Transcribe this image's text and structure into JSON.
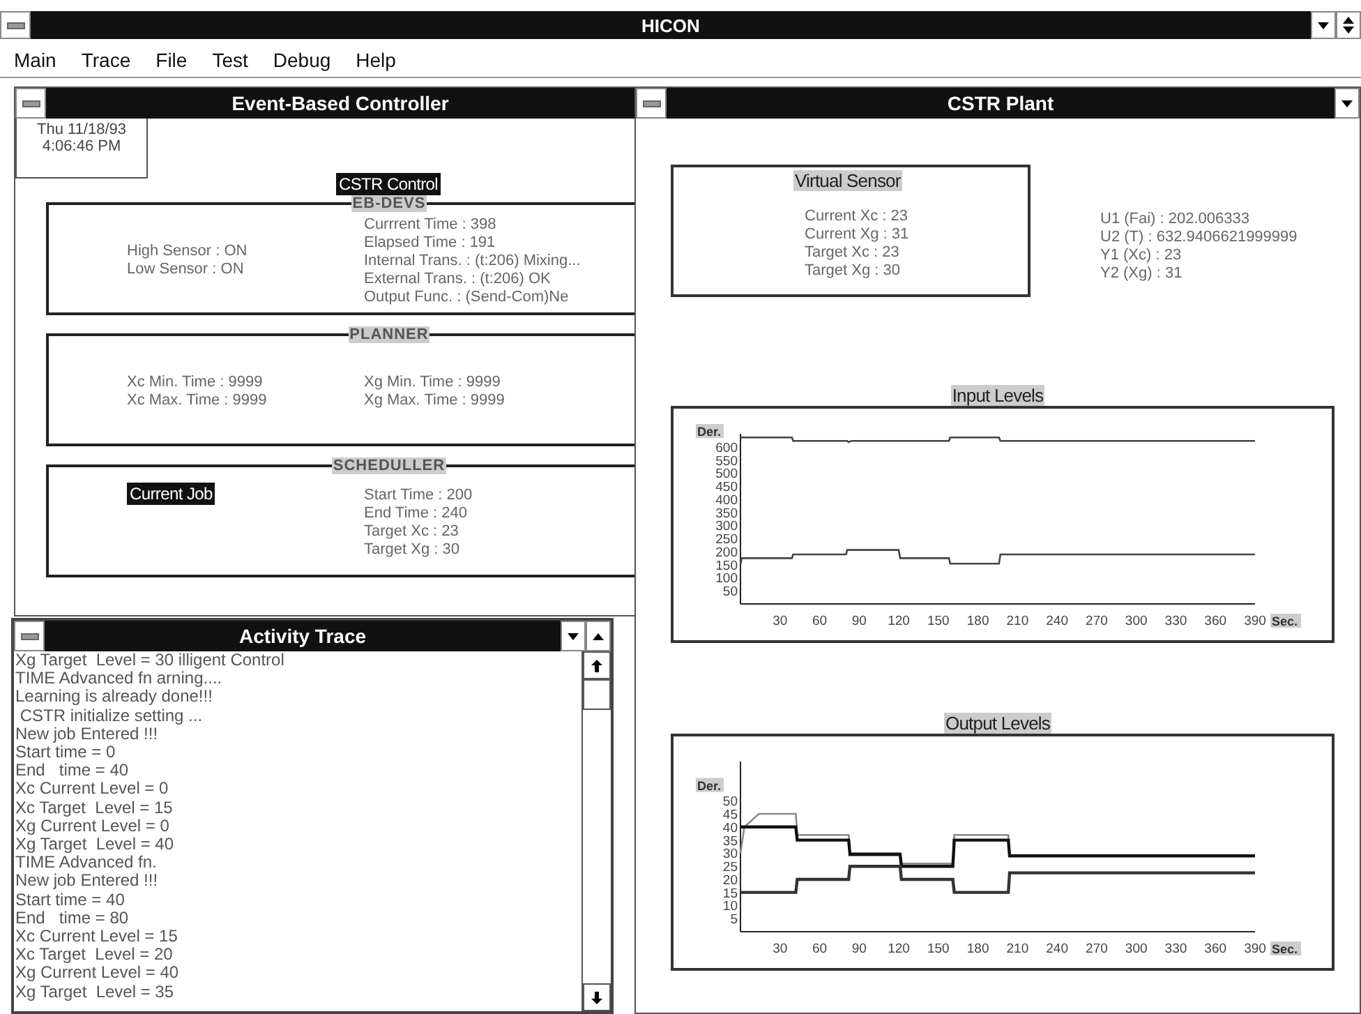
{
  "window": {
    "title": "HICON"
  },
  "menu": [
    "Main",
    "Trace",
    "File",
    "Test",
    "Debug",
    "Help"
  ],
  "controller": {
    "title": "Event-Based Controller",
    "clock": [
      "Thu 11/18/93",
      "4:06:46 PM"
    ],
    "heading": "CSTR Control",
    "sections": [
      {
        "title": "EB-DEVS",
        "columns": [
          [
            "High Sensor : ON",
            "Low Sensor : ON"
          ],
          [
            "Currrent Time : 398",
            "Elapsed Time : 191",
            "Internal Trans. : (t:206) Mixing...",
            "External Trans. : (t:206) OK",
            "Output Func. : (Send-Com)Ne"
          ]
        ]
      },
      {
        "title": "PLANNER",
        "columns": [
          [
            "Xc Min. Time : 9999",
            "Xc Max. Time : 9999"
          ],
          [
            "Xg Min. Time : 9999",
            "Xg Max. Time : 9999"
          ]
        ]
      },
      {
        "title": "SCHEDULLER",
        "badge": "Current Job",
        "columns": [
          [
            "Start Time : 200",
            "End Time : 240",
            "Target Xc : 23",
            "Target Xg : 30"
          ]
        ]
      }
    ]
  },
  "plant": {
    "title": "CSTR Plant",
    "sensor": {
      "title": "Virtual Sensor",
      "lines": [
        "Current Xc : 23",
        "Current Xg : 31",
        "Target Xc : 23",
        "Target Xg : 30"
      ]
    },
    "outputs": [
      "U1 (Fai) : 202.006333",
      "U2 (T) : 632.9406621999999",
      "Y1 (Xc) : 23",
      "Y2 (Xg) : 31"
    ],
    "charts": [
      {
        "chart_data": {
          "type": "line",
          "title": "Input Levels",
          "xlabel": "Sec.",
          "ylabel": "Der.",
          "xlim": [
            0,
            390
          ],
          "ylim": [
            0,
            650
          ],
          "xticks": [
            30,
            60,
            90,
            120,
            150,
            180,
            210,
            240,
            270,
            300,
            330,
            360,
            390
          ],
          "yticks": [
            50,
            100,
            150,
            200,
            250,
            300,
            350,
            400,
            450,
            500,
            550,
            600
          ],
          "x": [
            0,
            1,
            39,
            40,
            80,
            81,
            82,
            84,
            120,
            121,
            158,
            159,
            196,
            197,
            390
          ],
          "series": [
            {
              "color": "#444444",
              "values": [
                636,
                636,
                636,
                623,
                623,
                623,
                618,
                623,
                623,
                623,
                623,
                636,
                636,
                623,
                623
              ]
            },
            {
              "color": "#444444",
              "values": [
                150,
                175,
                175,
                189,
                189,
                206,
                206,
                206,
                206,
                175,
                175,
                154,
                154,
                189,
                189
              ]
            }
          ]
        }
      },
      {
        "chart_data": {
          "type": "line",
          "title": "Output Levels",
          "xlabel": "Sec.",
          "ylabel": "Der.",
          "xlim": [
            0,
            390
          ],
          "ylim": [
            0,
            65
          ],
          "xticks": [
            30,
            60,
            90,
            120,
            150,
            180,
            210,
            240,
            270,
            300,
            330,
            360,
            390
          ],
          "yticks": [
            5,
            10,
            15,
            20,
            25,
            30,
            35,
            40,
            45,
            50
          ],
          "x": [
            0,
            3,
            14,
            42,
            43,
            82,
            83,
            121,
            122,
            161,
            162,
            203,
            204,
            390
          ],
          "series": [
            {
              "color": "#888888",
              "values": [
                30,
                40,
                45,
                45,
                37,
                37,
                30,
                30,
                26,
                26,
                37,
                37,
                29,
                29
              ]
            },
            {
              "color": "#111111",
              "values": [
                40,
                40,
                40,
                40,
                35,
                35,
                29.5,
                29.5,
                25,
                25,
                35,
                35,
                29,
                29
              ]
            },
            {
              "color": "#333333",
              "values": [
                15,
                15,
                15,
                15,
                20,
                20,
                25,
                25,
                20,
                20,
                15,
                15,
                22.5,
                22.5
              ]
            }
          ]
        }
      }
    ]
  },
  "trace": {
    "title": "Activity Trace",
    "lines": [
      "Xg Target  Level = 30 illigent Control",
      "TIME Advanced fn arning....",
      "Learning is already done!!!",
      " CSTR initialize setting ...",
      "New job Entered !!!",
      "Start time = 0",
      "End   time = 40",
      "Xc Current Level = 0",
      "Xc Target  Level = 15",
      "Xg Current Level = 0",
      "Xg Target  Level = 40",
      "TIME Advanced fn.",
      "New job Entered !!!",
      "Start time = 40",
      "End   time = 80",
      "Xc Current Level = 15",
      "Xc Target  Level = 20",
      "Xg Current Level = 40",
      "Xg Target  Level = 35"
    ]
  }
}
